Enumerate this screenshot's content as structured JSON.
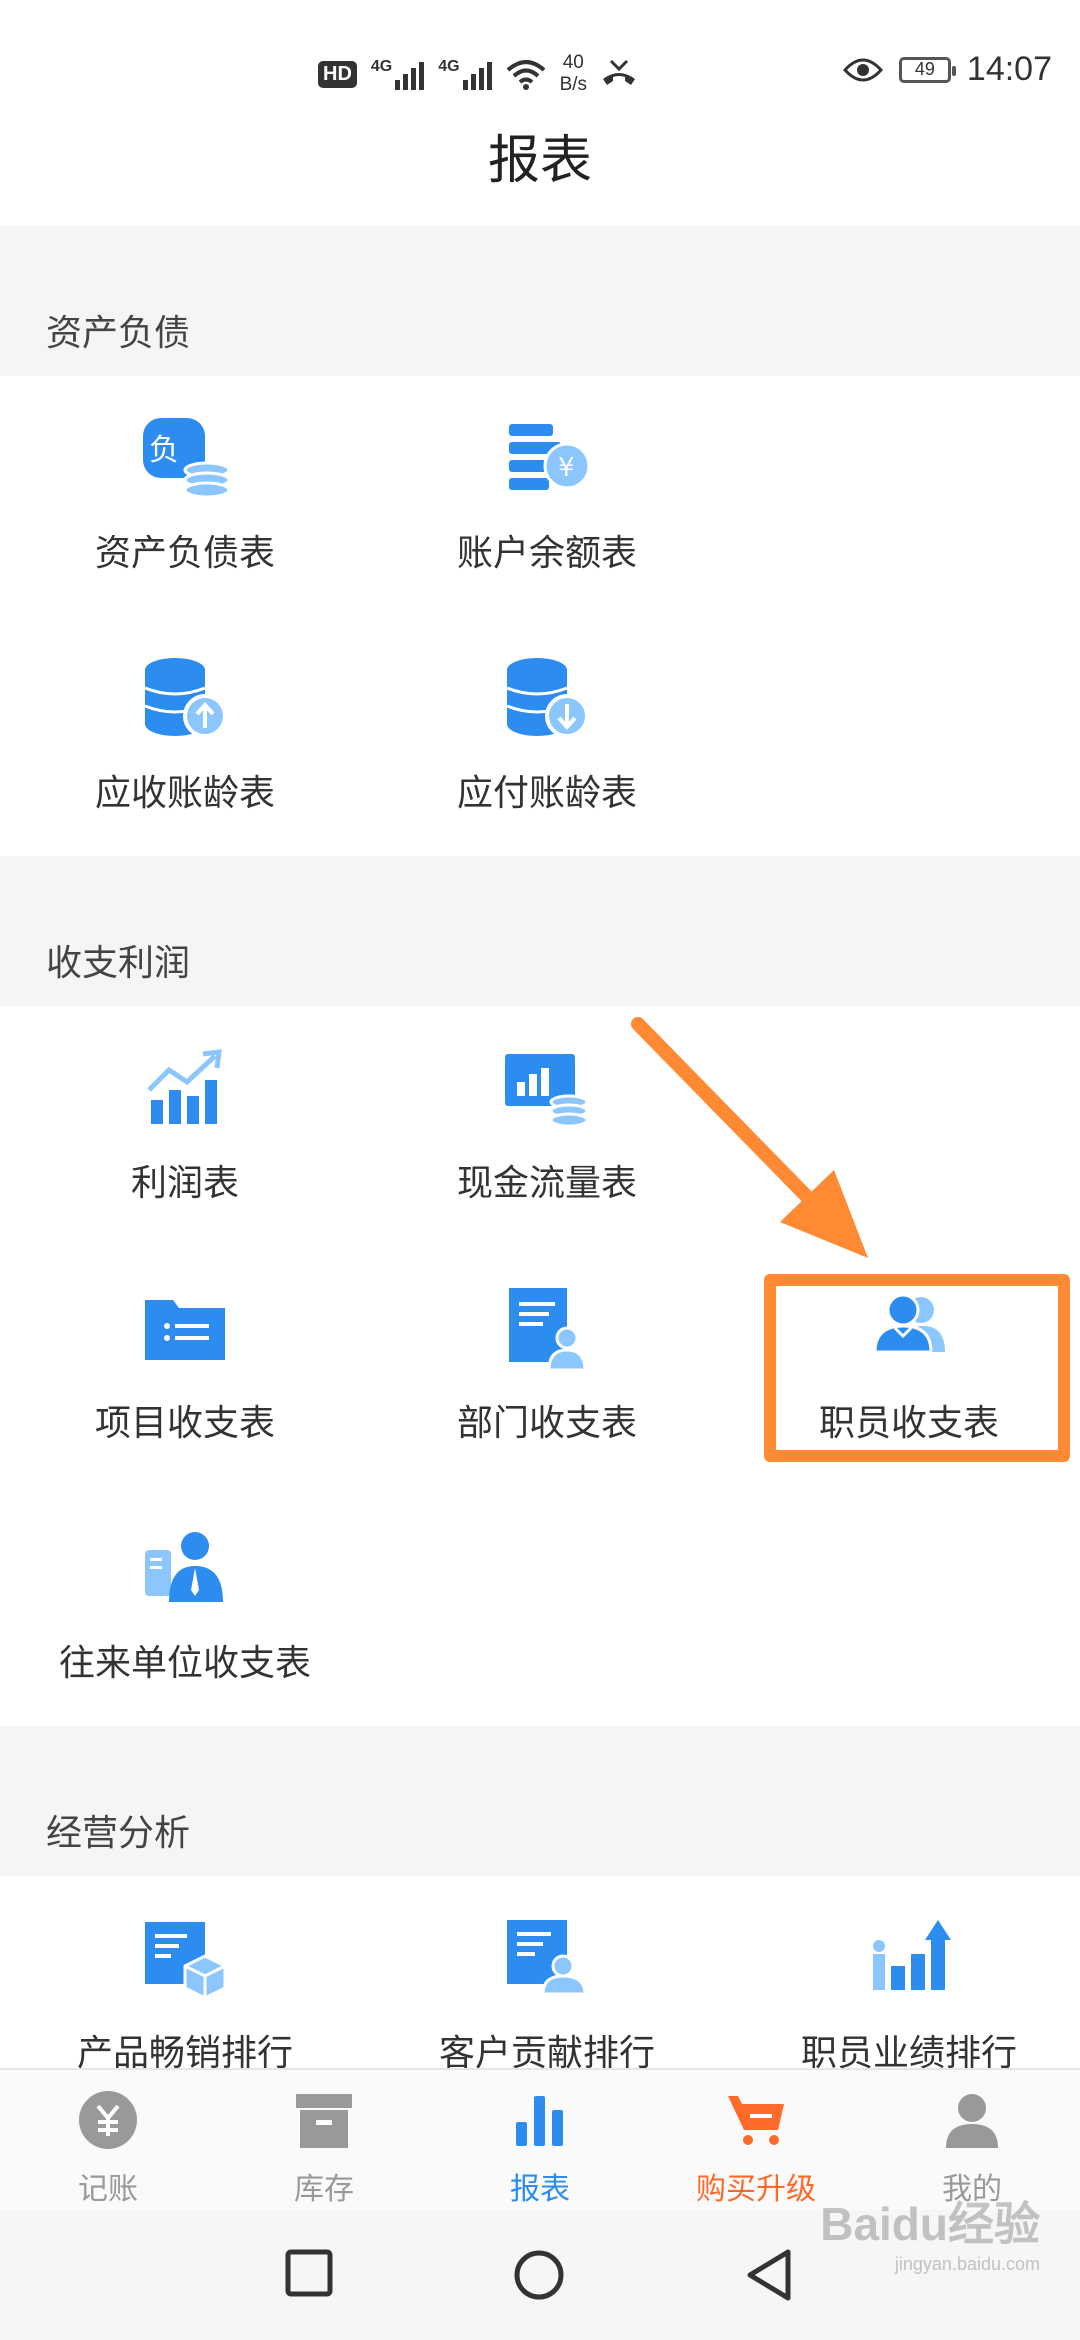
{
  "status_bar": {
    "hd": "HD",
    "net1": "4G",
    "net2": "4G",
    "speed_value": "40",
    "speed_unit": "B/s",
    "battery": "49",
    "time": "14:07"
  },
  "page": {
    "title": "报表"
  },
  "sections": {
    "assets": {
      "title": "资产负债",
      "items": [
        "资产负债表",
        "账户余额表",
        "应收账龄表",
        "应付账龄表"
      ]
    },
    "income": {
      "title": "收支利润",
      "items": [
        "利润表",
        "现金流量表",
        "项目收支表",
        "部门收支表",
        "职员收支表",
        "往来单位收支表"
      ]
    },
    "analysis": {
      "title": "经营分析",
      "items": [
        "产品畅销排行",
        "客户贡献排行",
        "职员业绩排行"
      ]
    }
  },
  "tabs": [
    "记账",
    "库存",
    "报表",
    "购买升级",
    "我的"
  ],
  "colors": {
    "accent": "#2d8cf0",
    "light_accent": "#8cc6ff",
    "promo": "#ff6a2b",
    "highlight": "#ff8a33"
  },
  "watermark": {
    "brand": "Baidu经验",
    "url": "jingyan.baidu.com"
  }
}
